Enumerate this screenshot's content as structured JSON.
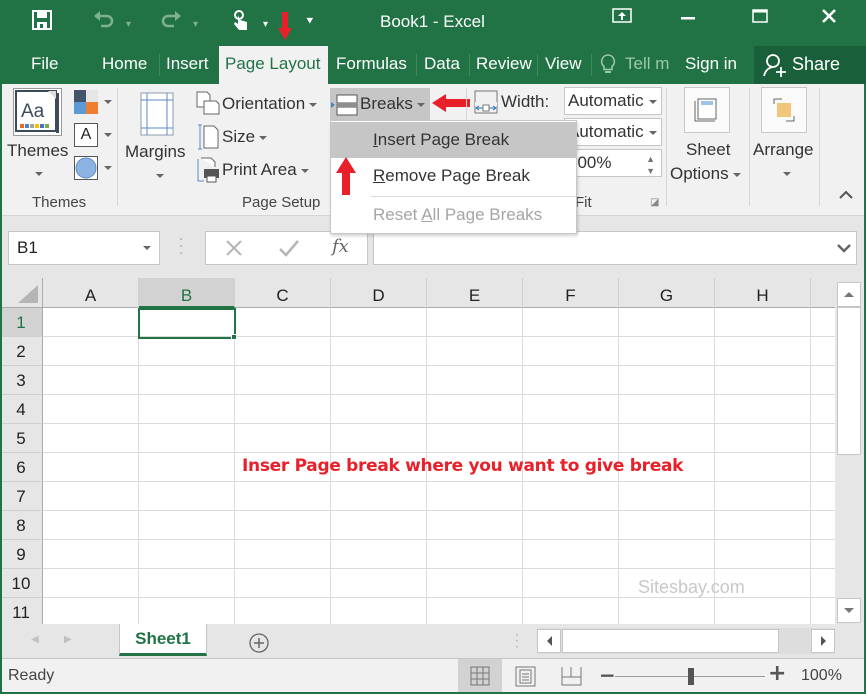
{
  "window": {
    "title": "Book1 - Excel",
    "accent_color": "#217346"
  },
  "qat": {
    "save_icon": "save-icon",
    "undo_icon": "undo-icon",
    "redo_icon": "redo-icon",
    "touch_icon": "touch-mode-icon",
    "customize_icon": "customize-qat-icon"
  },
  "tabs": [
    {
      "label": "File"
    },
    {
      "label": "Home"
    },
    {
      "label": "Insert"
    },
    {
      "label": "Page Layout",
      "active": true
    },
    {
      "label": "Formulas"
    },
    {
      "label": "Data"
    },
    {
      "label": "Review"
    },
    {
      "label": "View"
    },
    {
      "label": "Tell m"
    }
  ],
  "account": {
    "sign_in": "Sign in",
    "share": "Share"
  },
  "ribbon": {
    "themes_group": {
      "themes_label": "Themes",
      "group_label": "Themes"
    },
    "page_setup": {
      "margins_label": "Margins",
      "orientation_label": "Orientation",
      "size_label": "Size",
      "print_area_label": "Print Area",
      "breaks_label": "Breaks",
      "group_label": "Page Setup"
    },
    "scale_to_fit": {
      "width_label": "Width:",
      "width_value": "Automatic",
      "height_value": "Automatic",
      "scale_value": "100%",
      "group_label": "Fit"
    },
    "sheet_options_label_1": "Sheet",
    "sheet_options_label_2": "Options",
    "arrange_label": "Arrange"
  },
  "breaks_menu": {
    "items": [
      {
        "label_u": "I",
        "label_rest": "nsert Page Break",
        "state": "highlighted"
      },
      {
        "label_u": "R",
        "label_rest": "emove Page Break",
        "state": "enabled"
      },
      {
        "label_pre": "Reset ",
        "label_u": "A",
        "label_rest": "ll Page Breaks",
        "state": "disabled"
      }
    ]
  },
  "formula_bar": {
    "name_box": "B1",
    "cancel_icon": "cancel-icon",
    "enter_icon": "enter-icon",
    "fx_label": "fx",
    "formula": ""
  },
  "grid": {
    "columns": [
      "A",
      "B",
      "C",
      "D",
      "E",
      "F",
      "G",
      "H"
    ],
    "rows": [
      "1",
      "2",
      "3",
      "4",
      "5",
      "6",
      "7",
      "8",
      "9",
      "10",
      "11"
    ],
    "selected_cell": "B1",
    "annotation": "Inser Page break where you want to give break",
    "watermark": "Sitesbay.com"
  },
  "sheets": [
    {
      "label": "Sheet1",
      "active": true
    }
  ],
  "status_bar": {
    "status": "Ready",
    "zoom": "100%",
    "zoom_minus": "−",
    "zoom_plus": "+"
  }
}
